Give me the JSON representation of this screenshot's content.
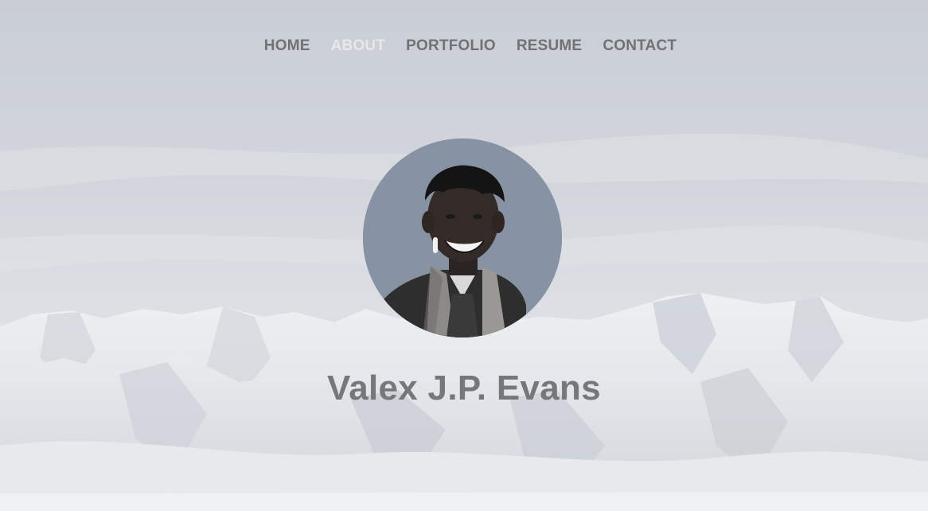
{
  "nav": {
    "items": [
      {
        "label": "HOME",
        "active": false
      },
      {
        "label": "ABOUT",
        "active": true
      },
      {
        "label": "PORTFOLIO",
        "active": false
      },
      {
        "label": "RESUME",
        "active": false
      },
      {
        "label": "CONTACT",
        "active": false
      }
    ]
  },
  "profile": {
    "name": "Valex J.P. Evans"
  },
  "colors": {
    "nav_text": "#6f7276",
    "nav_active": "#e6e8ec",
    "name_text": "#757779",
    "avatar_bg": "#8792a2"
  }
}
